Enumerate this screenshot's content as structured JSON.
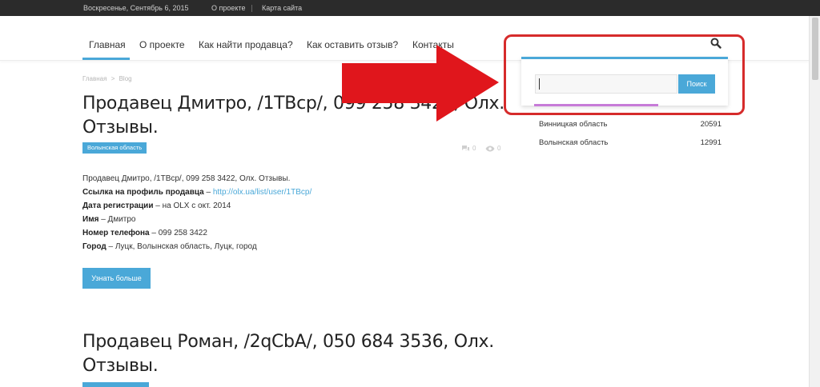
{
  "topbar": {
    "date": "Воскресенье, Сентябрь 6, 2015",
    "links": [
      "О проекте",
      "Карта сайта"
    ]
  },
  "nav": {
    "items": [
      "Главная",
      "О проекте",
      "Как найти продавца?",
      "Как оставить отзыв?",
      "Контакты"
    ],
    "active_index": 0
  },
  "breadcrumb": {
    "home": "Главная",
    "separator": ">",
    "current": "Blog"
  },
  "posts": [
    {
      "title": "Продавец Дмитро, /1TBcp/, 099 258 3422, Олх. Отзывы.",
      "badge": "Волынская область",
      "comments": "0",
      "views": "0",
      "intro": "Продавец Дмитро, /1TBcp/, 099 258 3422, Олх. Отзывы.",
      "fields": [
        {
          "label": "Ссылка на профиль продавца",
          "sep": " – ",
          "value": "http://olx.ua/list/user/1TBcp/",
          "is_link": true
        },
        {
          "label": "Дата регистрации",
          "sep": " – ",
          "value": "на OLX с окт. 2014",
          "is_link": false
        },
        {
          "label": "Имя",
          "sep": " – ",
          "value": "Дмитро",
          "is_link": false
        },
        {
          "label": "Номер телефона",
          "sep": " – ",
          "value": "099 258 3422",
          "is_link": false
        },
        {
          "label": "Город",
          "sep": " – ",
          "value": "Луцк, Волынская область, Луцк, город",
          "is_link": false
        }
      ],
      "more_label": "Узнать больше"
    },
    {
      "title": "Продавец Роман, /2qCbA/, 050 684 3536, Олх. Отзывы."
    }
  ],
  "sidebar": {
    "regions": [
      {
        "name": "Винницкая область",
        "count": "20591"
      },
      {
        "name": "Волынская область",
        "count": "12991"
      }
    ]
  },
  "search": {
    "value": "",
    "button_label": "Поиск"
  },
  "colors": {
    "accent": "#4aa8d8",
    "annotation": "#e0161c",
    "topbar": "#2b2b2b"
  }
}
